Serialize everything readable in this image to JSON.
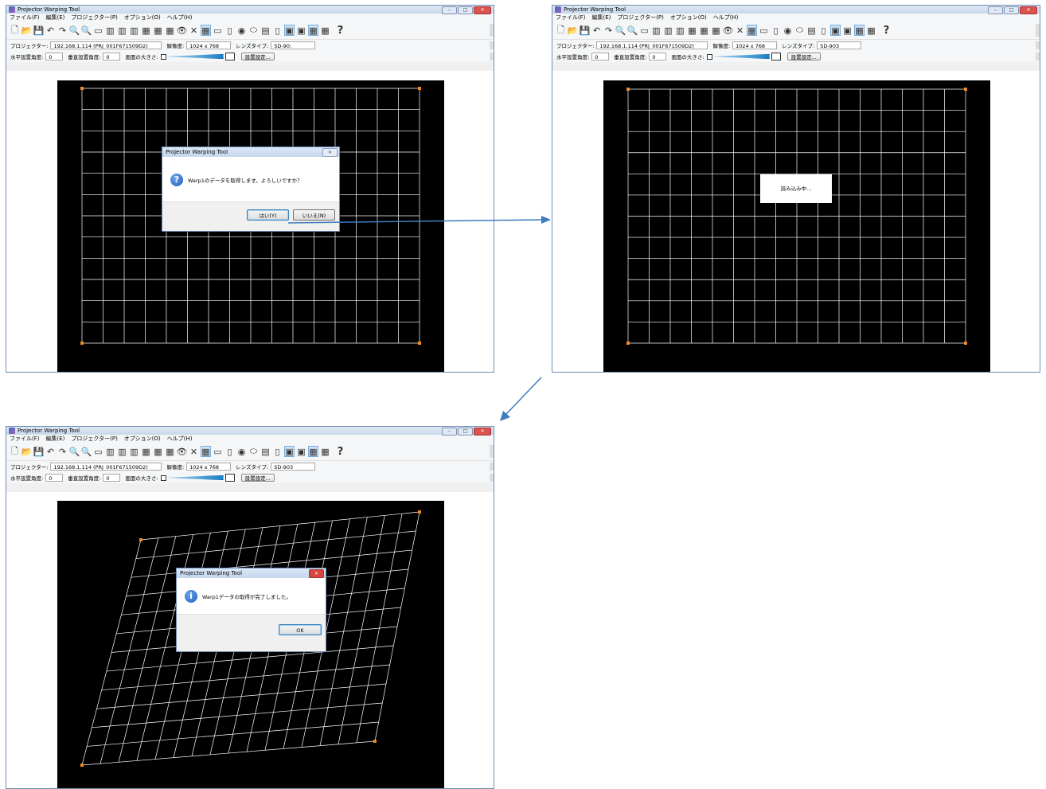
{
  "app": {
    "title": "Projector Warping Tool",
    "menu": [
      "ファイル(F)",
      "編集(E)",
      "プロジェクター(P)",
      "オプション(O)",
      "ヘルプ(H)"
    ],
    "projector_label": "プロジェクター:",
    "projector_value": "192.168.1.114 (PRJ_001F671509D2)",
    "resolution_label": "解像度:",
    "resolution_value": "1024 x 768",
    "lens_label": "レンズタイプ:",
    "lens_value": "SD-903",
    "lens_value_cut": "SD-90:",
    "h_angle_label": "水平設置角度:",
    "h_angle_value": "0",
    "v_angle_label": "垂直設置角度:",
    "v_angle_value": "0",
    "screen_size_label": "画面の大きさ:",
    "settings_button": "設置設定...",
    "toolbar_icons": [
      "new-icon",
      "open-icon",
      "save-icon",
      "undo-icon",
      "redo-icon",
      "zoom-in-icon",
      "zoom-out-icon",
      "link-icon",
      "warp-a-icon",
      "warp-b-icon",
      "warp-c-icon",
      "blend-a-icon",
      "blend-b-icon",
      "blend-c-icon",
      "eye-icon",
      "test-pattern-icon",
      "grid-view-icon",
      "grid-alt-icon",
      "cylinder-icon",
      "sphere-icon",
      "ellipse-icon",
      "keystone-icon",
      "pillow-icon",
      "fit-icon",
      "expand-icon",
      "grid-table-icon",
      "grid-table-alt-icon",
      "help-icon"
    ],
    "toolbar_glyphs": [
      "🗋",
      "📂",
      "💾",
      "↶",
      "↷",
      "🔍",
      "🔍",
      "▭",
      "▥",
      "▥",
      "▥",
      "▦",
      "▦",
      "▦",
      "👁",
      "✕",
      "▦",
      "▭",
      "▯",
      "◉",
      "⬭",
      "▤",
      "▯",
      "▣",
      "▣",
      "▦",
      "▦",
      "?"
    ]
  },
  "dialogs": {
    "confirm": {
      "title": "Projector Warping Tool",
      "message": "Warp1のデータを取得します。よろしいですか？",
      "yes": "はい(Y)",
      "no": "いいえ(N)"
    },
    "loading": {
      "message": "読み込み中..."
    },
    "done": {
      "title": "Projector Warping Tool",
      "message": "Warp1データの取得が完了しました。",
      "ok": "OK"
    }
  },
  "colors": {
    "grid_line": "#ffffff",
    "corner_handle": "#f08a24",
    "arrow": "#3e7cc0"
  }
}
